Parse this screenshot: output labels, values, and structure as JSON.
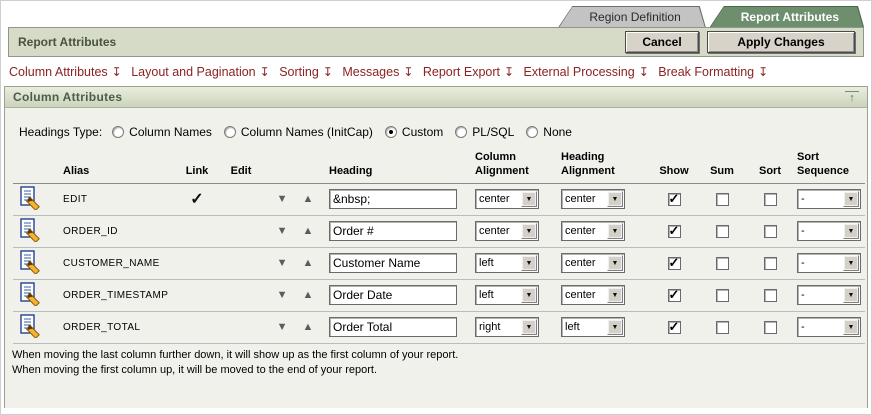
{
  "tabs": [
    {
      "label": "Region Definition",
      "active": false
    },
    {
      "label": "Report Attributes",
      "active": true
    }
  ],
  "toolbar": {
    "title": "Report Attributes",
    "cancel_label": "Cancel",
    "apply_label": "Apply Changes"
  },
  "nav": {
    "items": [
      {
        "label": "Column Attributes"
      },
      {
        "label": "Layout and Pagination"
      },
      {
        "label": "Sorting"
      },
      {
        "label": "Messages"
      },
      {
        "label": "Report Export"
      },
      {
        "label": "External Processing"
      },
      {
        "label": "Break Formatting"
      }
    ]
  },
  "region": {
    "title": "Column Attributes"
  },
  "headings_type": {
    "label": "Headings Type:",
    "options": [
      {
        "label": "Column Names",
        "selected": false
      },
      {
        "label": "Column Names (InitCap)",
        "selected": false
      },
      {
        "label": "Custom",
        "selected": true
      },
      {
        "label": "PL/SQL",
        "selected": false
      },
      {
        "label": "None",
        "selected": false
      }
    ]
  },
  "table": {
    "headers": {
      "alias": "Alias",
      "link": "Link",
      "edit": "Edit",
      "heading": "Heading",
      "column_alignment": "Column Alignment",
      "heading_alignment": "Heading Alignment",
      "show": "Show",
      "sum": "Sum",
      "sort": "Sort",
      "sort_sequence": "Sort Sequence"
    },
    "rows": [
      {
        "alias": "EDIT",
        "link": true,
        "heading": "&nbsp;",
        "column_alignment": "center",
        "heading_alignment": "center",
        "show": true,
        "sum": false,
        "sort": false,
        "sort_sequence": "-"
      },
      {
        "alias": "ORDER_ID",
        "link": false,
        "heading": "Order #",
        "column_alignment": "center",
        "heading_alignment": "center",
        "show": true,
        "sum": false,
        "sort": false,
        "sort_sequence": "-"
      },
      {
        "alias": "CUSTOMER_NAME",
        "link": false,
        "heading": "Customer Name",
        "column_alignment": "left",
        "heading_alignment": "center",
        "show": true,
        "sum": false,
        "sort": false,
        "sort_sequence": "-"
      },
      {
        "alias": "ORDER_TIMESTAMP",
        "link": false,
        "heading": "Order Date",
        "column_alignment": "left",
        "heading_alignment": "center",
        "show": true,
        "sum": false,
        "sort": false,
        "sort_sequence": "-"
      },
      {
        "alias": "ORDER_TOTAL",
        "link": false,
        "heading": "Order Total",
        "column_alignment": "right",
        "heading_alignment": "left",
        "show": true,
        "sum": false,
        "sort": false,
        "sort_sequence": "-"
      }
    ]
  },
  "notes": [
    "When moving the last column further down, it will show up as the first column of your report.",
    "When moving the first column up, it will be moved to the end of your report."
  ],
  "icons": {
    "checkmark": "✓",
    "move_down": "▼",
    "move_up": "▲",
    "dropdown": "▼",
    "nav_arrow": "↧",
    "collapse_up": "↑"
  },
  "colors": {
    "tab_active": "#6e8f6e",
    "toolbar_bg": "#d5dbc6",
    "nav_link": "#8b2323",
    "region_body_bg": "#f1f1ec"
  }
}
